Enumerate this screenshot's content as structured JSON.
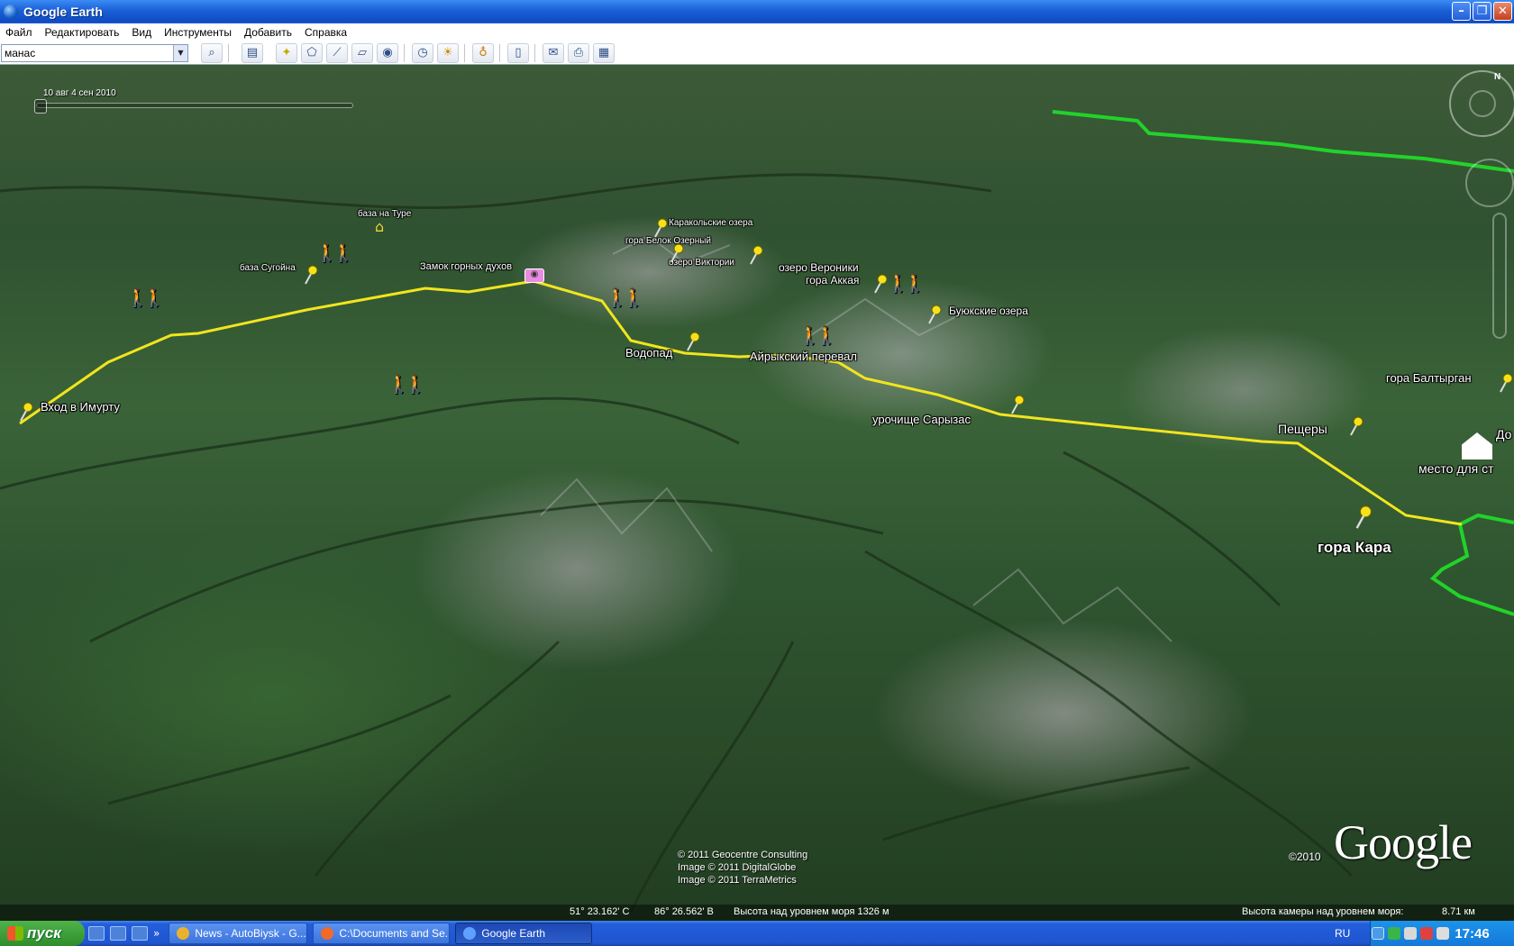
{
  "window": {
    "title": "Google Earth"
  },
  "menu": [
    "Файл",
    "Редактировать",
    "Вид",
    "Инструменты",
    "Добавить",
    "Справка"
  ],
  "search": {
    "value": "манас"
  },
  "toolbar": {
    "icons": [
      "sidebar-toggle-icon",
      "placemark-icon",
      "polygon-icon",
      "path-icon",
      "image-overlay-icon",
      "record-tour-icon",
      "historical-imagery-icon",
      "sunlight-icon",
      "planets-icon",
      "ruler-icon",
      "email-icon",
      "print-icon",
      "view-in-maps-icon"
    ]
  },
  "time_slider": {
    "label": "10 авг 4 сен 2010"
  },
  "places": {
    "baza_na_ture": "база на Туре",
    "karakolskie_ozera": "Каракольские озера",
    "gora_belok": "гора Белок Озерный",
    "ozero_viktorii": "озеро Виктории",
    "baza_sugoina": "база Сугойна",
    "zamok": "Замок горных духов",
    "ozero_veroniki": "озеро Вероники",
    "gora_akkaya": "гора Аккая",
    "buyukskie_ozera": "Буюкские озера",
    "vodopad": "Водопад",
    "airykskiy_pereval": "Айрыкский перевал",
    "vkhod": "Вход в Имурту",
    "sarizas": "урочище Сарызас",
    "gora_baltyrgan": "гора Балтырган",
    "peshchery": "Пещеры",
    "do": "До",
    "mesto": "место для ст",
    "gora_kara": "гора Кара"
  },
  "attribution": {
    "line1": "© 2011 Geocentre Consulting",
    "line2": "Image © 2011 DigitalGlobe",
    "line3": "Image © 2011 TerraMetrics"
  },
  "logo": {
    "year": "©2010",
    "text": "Google"
  },
  "status": {
    "lat": "51° 23.162' С",
    "lon": "86° 26.562' В",
    "elevation": "Высота над уровнем моря  1326 м",
    "camera_label": "Высота камеры над уровнем моря:",
    "camera_value": "8.71 км"
  },
  "taskbar": {
    "start": "пуск",
    "tasks": [
      {
        "label": "News - AutoBiysk - G...",
        "color": "#e8b230"
      },
      {
        "label": "C:\\Documents and Se...",
        "color": "#f06a2a"
      },
      {
        "label": "Google Earth",
        "color": "#5ea0ff"
      }
    ],
    "lang": "RU",
    "clock": "17:46"
  },
  "colors": {
    "route": "#f1e51e",
    "boundary": "#22d22a",
    "titlebar": "#0f4cc4"
  }
}
